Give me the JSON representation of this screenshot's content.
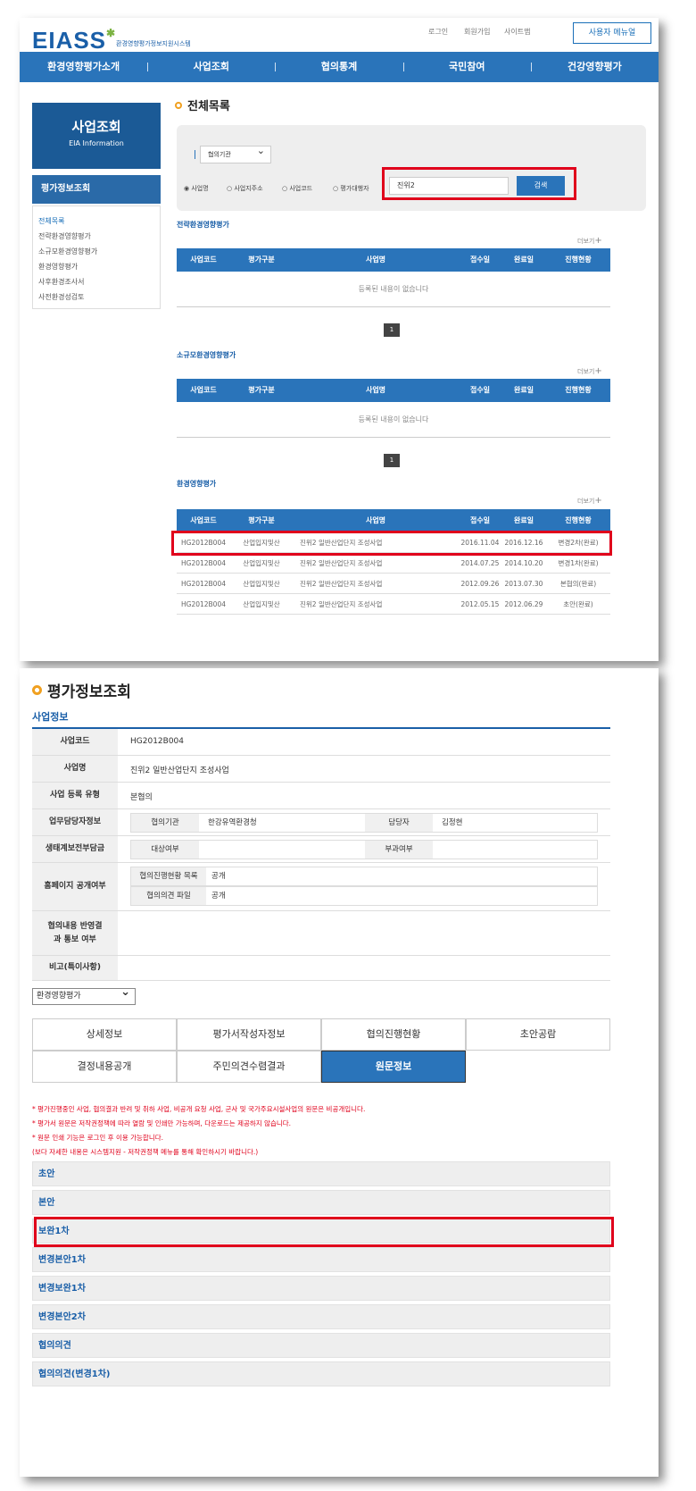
{
  "header": {
    "logo": "EIASS",
    "logo_sub": "환경영향평가정보지원시스템",
    "util": [
      "로그인",
      "회원가입",
      "사이트맵"
    ],
    "user_manual": "사용자 메뉴얼"
  },
  "gnb": [
    "환경영향평가소개",
    "사업조회",
    "협의통계",
    "국민참여",
    "건강영향평가"
  ],
  "lnb": {
    "title": "사업조회",
    "subtitle": "EIA Information",
    "section": "평가정보조회",
    "items": [
      "전체목록",
      "전략환경영향평가",
      "소규모환경영향평가",
      "환경영향평가",
      "사후환경조사서",
      "사전환경성검토"
    ]
  },
  "main": {
    "title": "전체목록",
    "search": {
      "select": "협의기관",
      "radios": [
        "사업명",
        "사업지주소",
        "사업코드",
        "평가대행자"
      ],
      "query": "진위2",
      "button": "검색"
    },
    "more": "더보기",
    "columns": [
      "사업코드",
      "평가구분",
      "사업명",
      "접수일",
      "완료일",
      "진행현황"
    ],
    "empty_text": "등록된 내용이 없습니다",
    "page": "1",
    "sections": [
      "전략환경영향평가",
      "소규모환경영향평가",
      "환경영향평가"
    ],
    "rows": [
      [
        "HG2012B004",
        "산업입지및산",
        "진위2 일반산업단지 조성사업",
        "2016.11.04",
        "2016.12.16",
        "변경2차(완료)"
      ],
      [
        "HG2012B004",
        "산업입지및산",
        "진위2 일반산업단지 조성사업",
        "2014.07.25",
        "2014.10.20",
        "변경1차(완료)"
      ],
      [
        "HG2012B004",
        "산업입지및산",
        "진위2 일반산업단지 조성사업",
        "2012.09.26",
        "2013.07.30",
        "본협의(완료)"
      ],
      [
        "HG2012B004",
        "산업입지및산",
        "진위2 일반산업단지 조성사업",
        "2012.05.15",
        "2012.06.29",
        "초안(완료)"
      ]
    ]
  },
  "detail": {
    "title": "평가정보조회",
    "info_title": "사업정보",
    "code_label": "사업코드",
    "code": "HG2012B004",
    "name_label": "사업명",
    "name": "진위2 일반산업단지 조성사업",
    "type_label": "사업 등록 유형",
    "type": "본협의",
    "staff_label": "업무담당자정보",
    "agency_label": "협의기관",
    "agency": "한강유역환경청",
    "person_label": "담당자",
    "person": "김정현",
    "eco_label": "생태계보전부담금",
    "target_label": "대상여부",
    "target": "",
    "levy_label": "부과여부",
    "levy": "",
    "public_label": "홈페이지 공개여부",
    "progress_list_label": "협의진행현황 목록",
    "progress_list": "공개",
    "opinion_file_label": "협의의견 파일",
    "opinion_file": "공개",
    "reflect_label": "협의내용 반영결과 통보 여부",
    "remark_label": "비고(특이사항)",
    "dropdown": "환경영향평가",
    "tabs": [
      "상세정보",
      "평가서작성자정보",
      "협의진행현황",
      "초안공람",
      "결정내용공개",
      "주민의견수렴결과",
      "원문정보"
    ],
    "notices": [
      "* 평가진행중인 사업, 협의결과 반려 및 취하 사업, 비공개 요청 사업, 군사 및 국가주요시설사업의 원문은 비공개입니다.",
      "* 평가서 원문은 저작권정책에 따라 열람 및 인쇄만 가능하며, 다운로드는 제공하지 않습니다.",
      "* 원문 인쇄 기능은 로그인 후 이용 가능합니다.",
      "(보다 자세한 내용은 시스템지원 - 저작권정책 메뉴를 통해 확인하시기 바랍니다.)"
    ],
    "docs": [
      "초안",
      "본안",
      "보완1차",
      "변경본안1차",
      "변경보완1차",
      "변경본안2차",
      "협의의견",
      "협의의견(변경1차)"
    ]
  },
  "colors": {
    "primary": "#2a74ba",
    "dark_blue": "#1b5a96",
    "highlight": "#e0001b",
    "accent": "#f0a020"
  }
}
